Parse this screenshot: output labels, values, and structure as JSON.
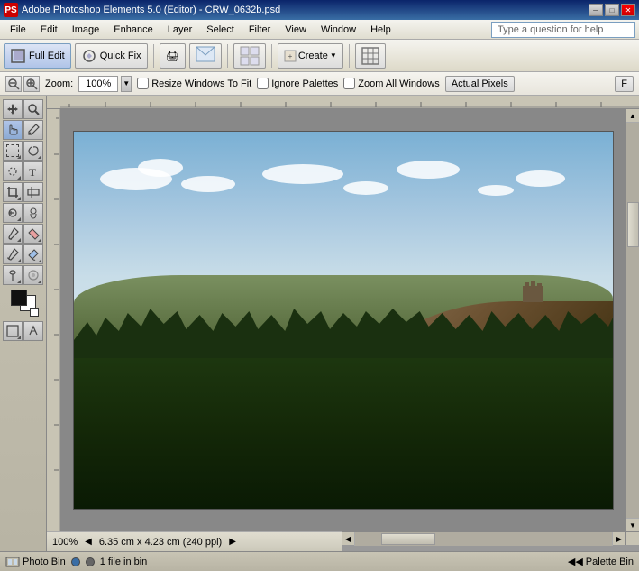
{
  "window": {
    "title": "Adobe Photoshop Elements 5.0 (Editor) - CRW_0632b.psd",
    "icon": "PS"
  },
  "menu": {
    "items": [
      "File",
      "Edit",
      "Image",
      "Enhance",
      "Layer",
      "Select",
      "Filter",
      "View",
      "Window",
      "Help"
    ]
  },
  "help": {
    "placeholder": "Type a question for help"
  },
  "toolbar": {
    "full_edit": "Full Edit",
    "quick_fix": "Quick Fix",
    "print_label": "🖨",
    "email_label": "✉",
    "create_label": "Create",
    "organize_icon": "⊞"
  },
  "options": {
    "zoom_label": "Zoom:",
    "zoom_value": "100%",
    "resize_windows": "Resize Windows To Fit",
    "ignore_palettes": "Ignore Palettes",
    "zoom_all_windows": "Zoom All Windows",
    "actual_pixels": "Actual Pixels",
    "fit_on_screen": "F"
  },
  "status": {
    "zoom": "100%",
    "dimensions": "6.35 cm x 4.23 cm (240 ppi)"
  },
  "bottom": {
    "photo_bin": "Photo Bin",
    "files_in_bin": "1 file in bin",
    "palette_bin": "Palette Bin"
  }
}
